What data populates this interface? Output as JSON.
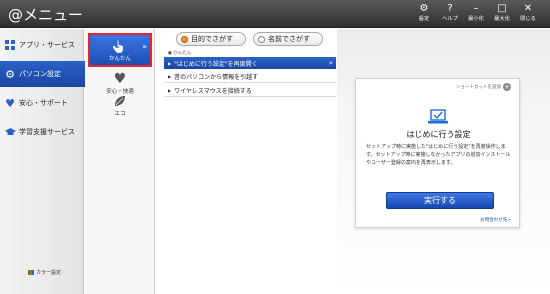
{
  "window": {
    "title": "@メニュー",
    "buttons": [
      {
        "label": "設定",
        "icon": "gear-icon"
      },
      {
        "label": "ヘルプ",
        "icon": "help-icon"
      },
      {
        "label": "最小化",
        "icon": "minimize-icon"
      },
      {
        "label": "最大化",
        "icon": "maximize-icon"
      },
      {
        "label": "閉じる",
        "icon": "close-icon"
      }
    ]
  },
  "categories": [
    {
      "label": "アプリ・サービス",
      "icon": "apps-grid-icon",
      "active": false
    },
    {
      "label": "パソコン設定",
      "icon": "gear-icon",
      "active": true
    },
    {
      "label": "安心・サポート",
      "icon": "heart-icon",
      "active": false
    },
    {
      "label": "学習支援サービス",
      "icon": "graduation-cap-icon",
      "active": false
    }
  ],
  "color_settings_label": "カラー設定",
  "subcategories": [
    {
      "label": "かんたん",
      "icon": "hand-pointer-icon",
      "selected": true
    },
    {
      "label": "安心・快適",
      "icon": "heart-icon",
      "selected": false
    },
    {
      "label": "エコ",
      "icon": "leaf-icon",
      "selected": false
    }
  ],
  "search_modes": {
    "purpose": "目的でさがす",
    "name": "名前でさがす",
    "active": "purpose"
  },
  "section_label": "かんたん",
  "items": [
    {
      "label": "\"はじめに行う設定\"を再度開く",
      "highlighted": true
    },
    {
      "label": "昔のパソコンから情報を引越す",
      "highlighted": false
    },
    {
      "label": "ワイヤレスマウスを接続する",
      "highlighted": false
    }
  ],
  "detail": {
    "shortcut_label": "ショートカットを追加",
    "title": "はじめに行う設定",
    "description": "セットアップ時に実施した\"はじめに行う設定\"を再度操作します。セットアップ時に実施しなかったアプリの追加インストールやユーザー登録の案内を再表示します。",
    "run_button": "実行する",
    "more_link": "お問合わせ先>"
  },
  "colors": {
    "accent_blue": "#1f4fb0",
    "titlebar": "#3a3a3a",
    "selected_border": "#e8252b",
    "radio_active": "#e07000"
  }
}
